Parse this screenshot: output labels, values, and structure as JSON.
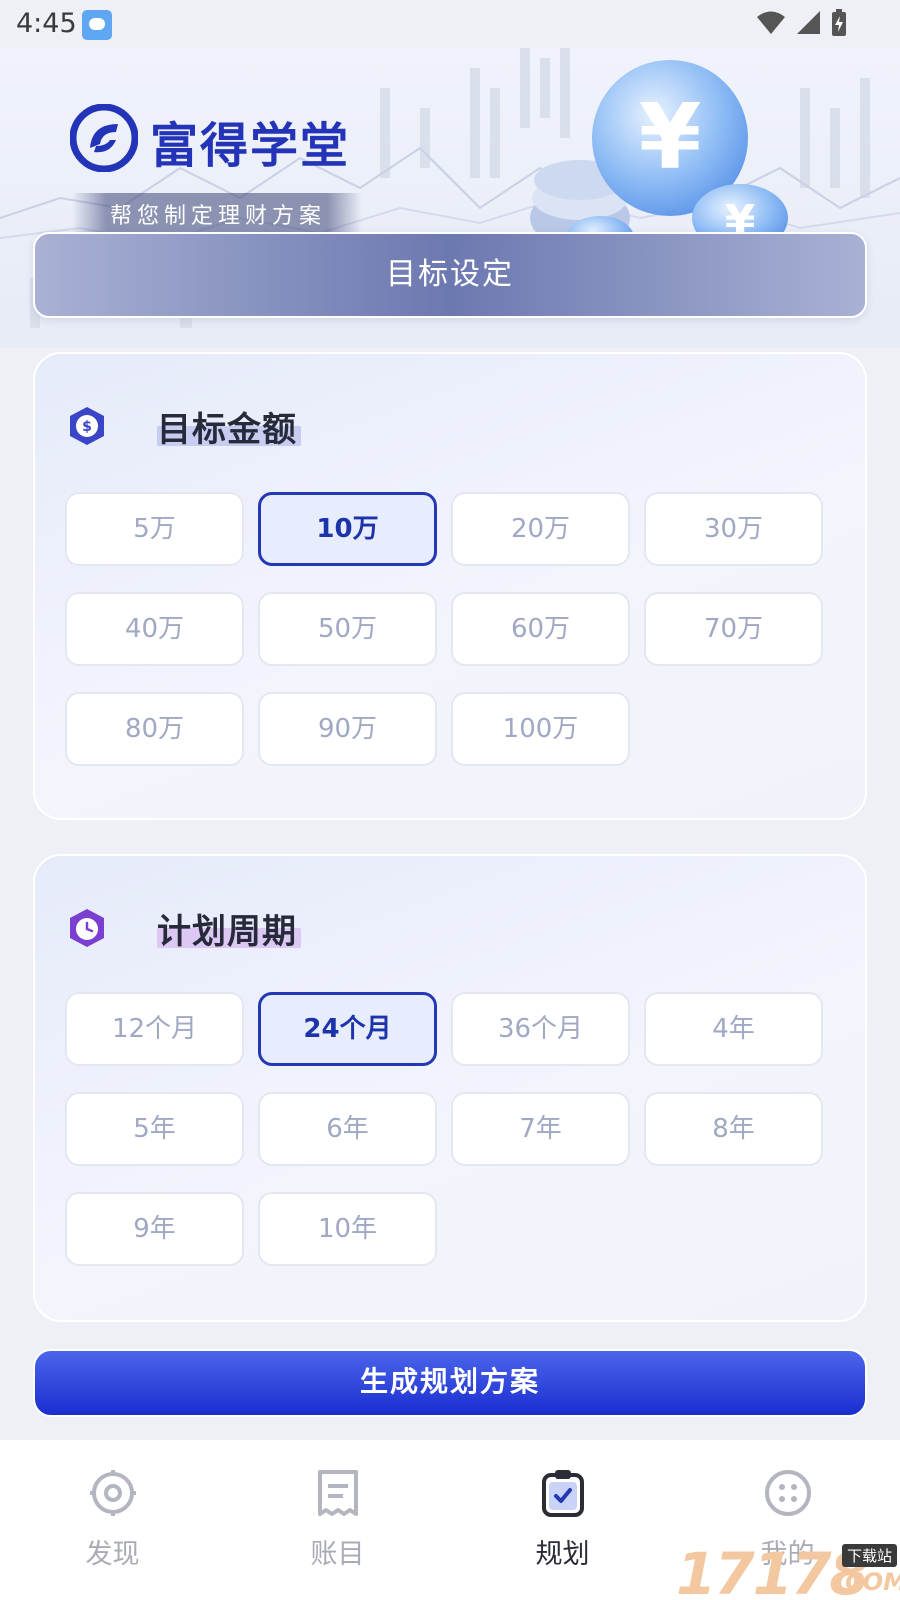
{
  "status_bar": {
    "time": "4:45"
  },
  "header": {
    "brand_name": "富得学堂",
    "tagline": "帮您制定理财方案",
    "section_title": "目标设定"
  },
  "amount": {
    "title": "目标金额",
    "options": [
      "5万",
      "10万",
      "20万",
      "30万",
      "40万",
      "50万",
      "60万",
      "70万",
      "80万",
      "90万",
      "100万"
    ],
    "selected": "10万"
  },
  "period": {
    "title": "计划周期",
    "options": [
      "12个月",
      "24个月",
      "36个月",
      "4年",
      "5年",
      "6年",
      "7年",
      "8年",
      "9年",
      "10年"
    ],
    "selected": "24个月"
  },
  "generate_button": "生成规划方案",
  "bottom_nav": [
    {
      "label": "发现",
      "icon": "target-icon",
      "active": false
    },
    {
      "label": "账目",
      "icon": "receipt-icon",
      "active": false
    },
    {
      "label": "规划",
      "icon": "clipboard-check-icon",
      "active": true
    },
    {
      "label": "我的",
      "icon": "dots-grid-icon",
      "active": false
    }
  ],
  "watermark": {
    "digits": "17178",
    "small": "下载站",
    "com": ".COM"
  },
  "colors": {
    "brand": "#2434b8",
    "selected_border": "#2438b4",
    "button_top": "#4b65ea",
    "button_bottom": "#1a2ed0",
    "amount_icon": "#3a45c8",
    "period_icon": "#7a3fd1"
  }
}
